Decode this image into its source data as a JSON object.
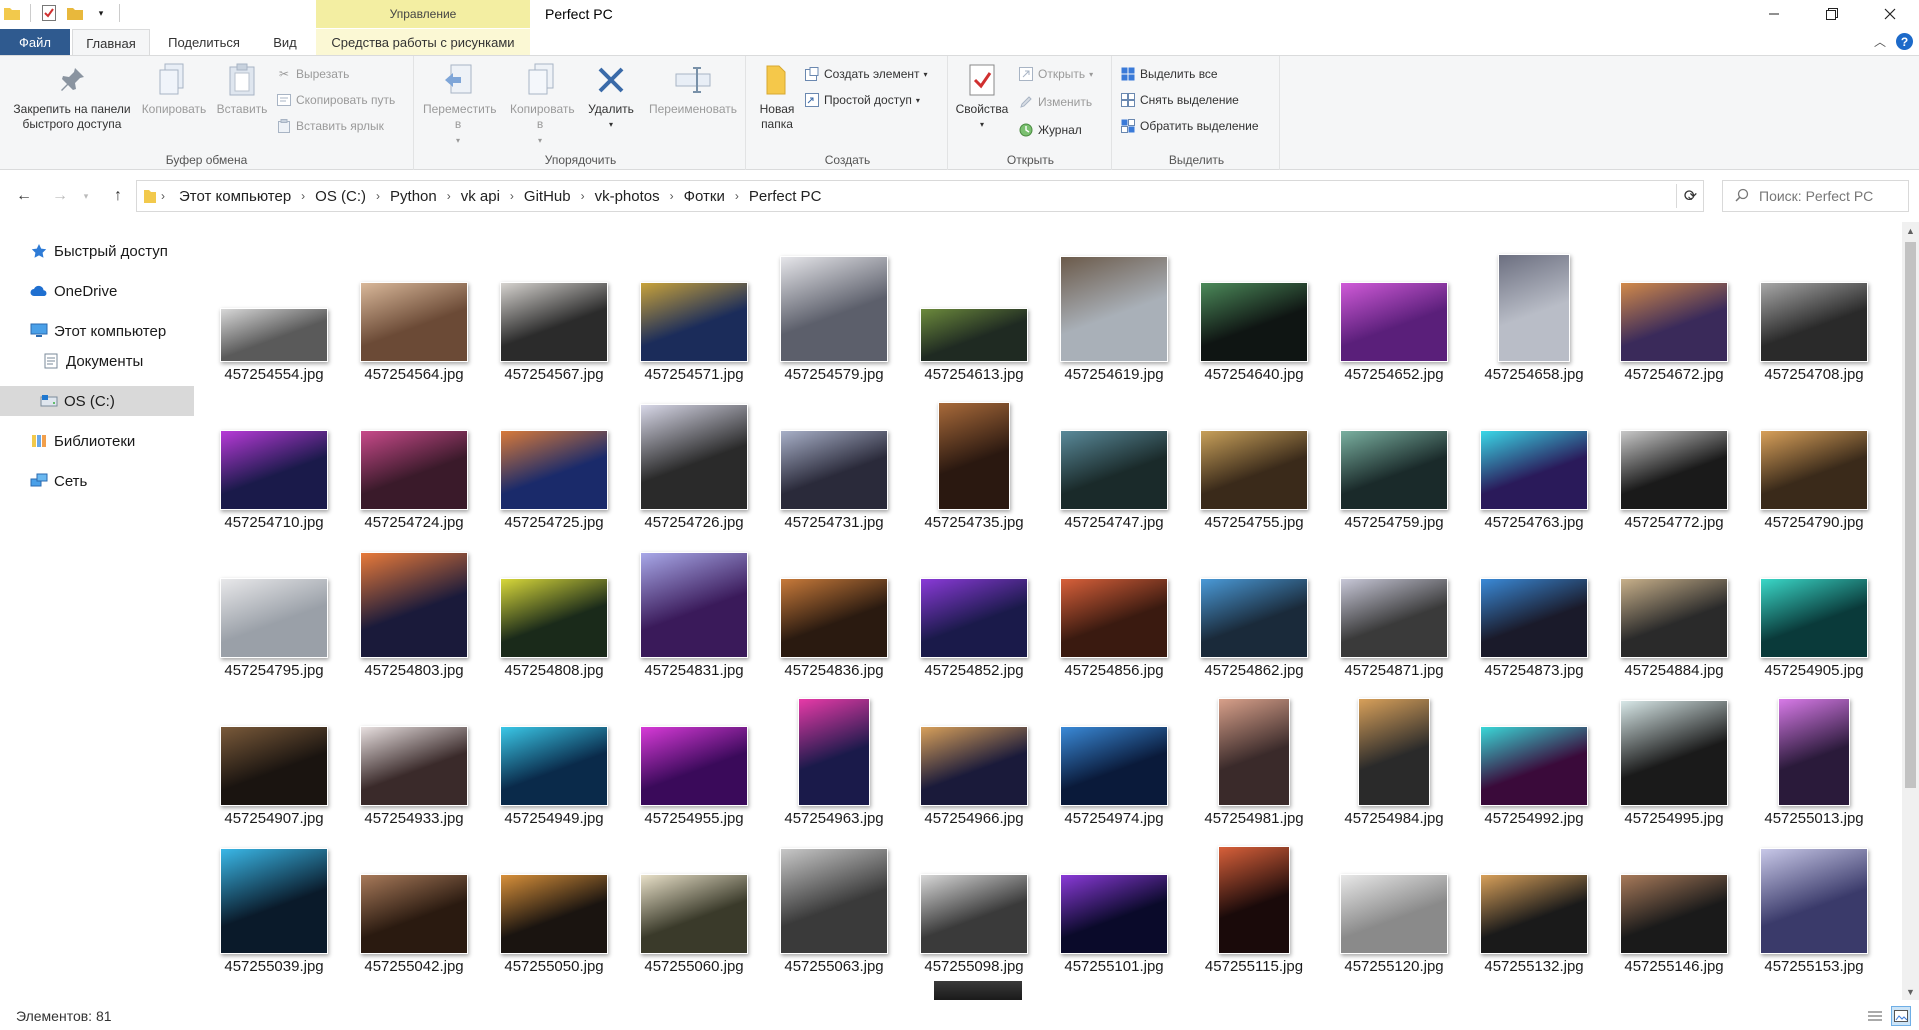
{
  "window": {
    "title": "Perfect PC",
    "context_tab_header": "Управление",
    "minimize_icon": "minimize-icon",
    "maximize_icon": "restore-icon",
    "close_icon": "close-icon"
  },
  "tabs": {
    "file": "Файл",
    "home": "Главная",
    "share": "Поделиться",
    "view": "Вид",
    "picture_tools": "Средства работы с рисунками"
  },
  "ribbon": {
    "clipboard": {
      "label": "Буфер обмена",
      "pin": "Закрепить на панели быстрого доступа",
      "copy": "Копировать",
      "paste": "Вставить",
      "cut": "Вырезать",
      "copy_path": "Скопировать путь",
      "paste_shortcut": "Вставить ярлык"
    },
    "organize": {
      "label": "Упорядочить",
      "move_to": "Переместить в",
      "copy_to": "Копировать в",
      "delete": "Удалить",
      "rename": "Переименовать"
    },
    "create": {
      "label": "Создать",
      "new_folder": "Новая папка",
      "new_item": "Создать элемент",
      "easy_access": "Простой доступ"
    },
    "open": {
      "label": "Открыть",
      "properties": "Свойства",
      "open": "Открыть",
      "edit": "Изменить",
      "history": "Журнал"
    },
    "select": {
      "label": "Выделить",
      "select_all": "Выделить все",
      "select_none": "Снять выделение",
      "invert": "Обратить выделение"
    }
  },
  "breadcrumbs": [
    "Этот компьютер",
    "OS (C:)",
    "Python",
    "vk api",
    "GitHub",
    "vk-photos",
    "Фотки",
    "Perfect PC"
  ],
  "search_placeholder": "Поиск: Perfect PC",
  "nav": {
    "quick_access": "Быстрый доступ",
    "onedrive": "OneDrive",
    "this_pc": "Этот компьютер",
    "documents": "Документы",
    "os_c": "OS (C:)",
    "libraries": "Библиотеки",
    "network": "Сеть"
  },
  "files": [
    {
      "name": "457254554.jpg",
      "orient": "wide",
      "c1": "#5a5a5a",
      "c2": "#d8d8d8"
    },
    {
      "name": "457254564.jpg",
      "orient": "land",
      "c1": "#6b4a36",
      "c2": "#d9b89a"
    },
    {
      "name": "457254567.jpg",
      "orient": "land",
      "c1": "#2b2b2b",
      "c2": "#d6d3cf"
    },
    {
      "name": "457254571.jpg",
      "orient": "land",
      "c1": "#1b2c5a",
      "c2": "#c8a23a"
    },
    {
      "name": "457254579.jpg",
      "orient": "square",
      "c1": "#5c5f6b",
      "c2": "#e6e6ea"
    },
    {
      "name": "457254613.jpg",
      "orient": "wide",
      "c1": "#1f2a22",
      "c2": "#6c8a3c"
    },
    {
      "name": "457254619.jpg",
      "orient": "square",
      "c1": "#a9b0b8",
      "c2": "#6b5a4a"
    },
    {
      "name": "457254640.jpg",
      "orient": "land",
      "c1": "#0f1513",
      "c2": "#4c8a5a"
    },
    {
      "name": "457254652.jpg",
      "orient": "land",
      "c1": "#5a1f7a",
      "c2": "#d05ad8"
    },
    {
      "name": "457254658.jpg",
      "orient": "port",
      "c1": "#b9bdc7",
      "c2": "#6c6f80"
    },
    {
      "name": "457254672.jpg",
      "orient": "land",
      "c1": "#3a2a5a",
      "c2": "#d28a4a"
    },
    {
      "name": "457254708.jpg",
      "orient": "land",
      "c1": "#2a2a2a",
      "c2": "#a8a8a8"
    },
    {
      "name": "457254710.jpg",
      "orient": "land",
      "c1": "#1a1a4a",
      "c2": "#b83ad8"
    },
    {
      "name": "457254724.jpg",
      "orient": "land",
      "c1": "#3a1a2a",
      "c2": "#c84a8a"
    },
    {
      "name": "457254725.jpg",
      "orient": "land",
      "c1": "#1a2a6a",
      "c2": "#d87a3a"
    },
    {
      "name": "457254726.jpg",
      "orient": "square",
      "c1": "#2a2a2a",
      "c2": "#d8d8e8"
    },
    {
      "name": "457254731.jpg",
      "orient": "land",
      "c1": "#2a2a3a",
      "c2": "#a8b0c8"
    },
    {
      "name": "457254735.jpg",
      "orient": "port",
      "c1": "#2a1810",
      "c2": "#a86a3a"
    },
    {
      "name": "457254747.jpg",
      "orient": "land",
      "c1": "#1a2a2a",
      "c2": "#5a8a9a"
    },
    {
      "name": "457254755.jpg",
      "orient": "land",
      "c1": "#3a2a1a",
      "c2": "#c8a05a"
    },
    {
      "name": "457254759.jpg",
      "orient": "land",
      "c1": "#1a2a2a",
      "c2": "#7ab0a0"
    },
    {
      "name": "457254763.jpg",
      "orient": "land",
      "c1": "#2a1a5a",
      "c2": "#3ad8e8"
    },
    {
      "name": "457254772.jpg",
      "orient": "land",
      "c1": "#1a1a1a",
      "c2": "#c8c8c8"
    },
    {
      "name": "457254790.jpg",
      "orient": "land",
      "c1": "#3a2a1a",
      "c2": "#d8a05a"
    },
    {
      "name": "457254795.jpg",
      "orient": "land",
      "c1": "#9aa0a8",
      "c2": "#e8e8ea"
    },
    {
      "name": "457254803.jpg",
      "orient": "square",
      "c1": "#1a1a3a",
      "c2": "#e87a3a"
    },
    {
      "name": "457254808.jpg",
      "orient": "land",
      "c1": "#1a2a1a",
      "c2": "#d8d83a"
    },
    {
      "name": "457254831.jpg",
      "orient": "square",
      "c1": "#3a1a5a",
      "c2": "#a8a8e8"
    },
    {
      "name": "457254836.jpg",
      "orient": "land",
      "c1": "#2a1a10",
      "c2": "#c87a3a"
    },
    {
      "name": "457254852.jpg",
      "orient": "land",
      "c1": "#1a1a4a",
      "c2": "#8a3ad8"
    },
    {
      "name": "457254856.jpg",
      "orient": "land",
      "c1": "#3a1a10",
      "c2": "#d8603a"
    },
    {
      "name": "457254862.jpg",
      "orient": "land",
      "c1": "#1a2a3a",
      "c2": "#4a9ad8"
    },
    {
      "name": "457254871.jpg",
      "orient": "land",
      "c1": "#3a3a3a",
      "c2": "#c8c8d8"
    },
    {
      "name": "457254873.jpg",
      "orient": "land",
      "c1": "#1a1a2a",
      "c2": "#3a8ad8"
    },
    {
      "name": "457254884.jpg",
      "orient": "land",
      "c1": "#2a2a2a",
      "c2": "#c8b08a"
    },
    {
      "name": "457254905.jpg",
      "orient": "land",
      "c1": "#0a3a3a",
      "c2": "#3ad8c8"
    },
    {
      "name": "457254907.jpg",
      "orient": "land",
      "c1": "#1a1410",
      "c2": "#7a5a3a"
    },
    {
      "name": "457254933.jpg",
      "orient": "land",
      "c1": "#3a2a2a",
      "c2": "#e8e0e0"
    },
    {
      "name": "457254949.jpg",
      "orient": "land",
      "c1": "#0a2a4a",
      "c2": "#3ac8e8"
    },
    {
      "name": "457254955.jpg",
      "orient": "land",
      "c1": "#3a0a5a",
      "c2": "#d83ad8"
    },
    {
      "name": "457254963.jpg",
      "orient": "port",
      "c1": "#1a1a4a",
      "c2": "#e83aa8"
    },
    {
      "name": "457254966.jpg",
      "orient": "land",
      "c1": "#1a1a3a",
      "c2": "#d8a05a"
    },
    {
      "name": "457254974.jpg",
      "orient": "land",
      "c1": "#0a1a3a",
      "c2": "#3a8ad8"
    },
    {
      "name": "457254981.jpg",
      "orient": "port",
      "c1": "#3a2a2a",
      "c2": "#d8a08a"
    },
    {
      "name": "457254984.jpg",
      "orient": "port",
      "c1": "#2a2a2a",
      "c2": "#d8a05a"
    },
    {
      "name": "457254992.jpg",
      "orient": "land",
      "c1": "#3a0a3a",
      "c2": "#3ad8d8"
    },
    {
      "name": "457254995.jpg",
      "orient": "square",
      "c1": "#1a1a1a",
      "c2": "#d8e8e8"
    },
    {
      "name": "457255013.jpg",
      "orient": "port",
      "c1": "#2a1a3a",
      "c2": "#d87ae8"
    },
    {
      "name": "457255039.jpg",
      "orient": "square",
      "c1": "#0a1a2a",
      "c2": "#3ab8e8"
    },
    {
      "name": "457255042.jpg",
      "orient": "land",
      "c1": "#2a1a10",
      "c2": "#a87a5a"
    },
    {
      "name": "457255050.jpg",
      "orient": "land",
      "c1": "#1a1410",
      "c2": "#d8903a"
    },
    {
      "name": "457255060.jpg",
      "orient": "land",
      "c1": "#3a3a2a",
      "c2": "#e8e0c8"
    },
    {
      "name": "457255063.jpg",
      "orient": "square",
      "c1": "#3a3a3a",
      "c2": "#c8c8c8"
    },
    {
      "name": "457255098.jpg",
      "orient": "land",
      "c1": "#3a3a3a",
      "c2": "#d8d8d8"
    },
    {
      "name": "457255101.jpg",
      "orient": "land",
      "c1": "#0a0a2a",
      "c2": "#8a3ad8"
    },
    {
      "name": "457255115.jpg",
      "orient": "port",
      "c1": "#1a0a0a",
      "c2": "#d8603a"
    },
    {
      "name": "457255120.jpg",
      "orient": "land",
      "c1": "#8a8a8a",
      "c2": "#e8e8e8"
    },
    {
      "name": "457255132.jpg",
      "orient": "land",
      "c1": "#1a1a1a",
      "c2": "#d8a05a"
    },
    {
      "name": "457255146.jpg",
      "orient": "land",
      "c1": "#1a1a1a",
      "c2": "#a87a5a"
    },
    {
      "name": "457255153.jpg",
      "orient": "square",
      "c1": "#3a3a6a",
      "c2": "#c8c8e8"
    }
  ],
  "status": {
    "item_count": "Элементов: 81",
    "details_view_icon": "details-view-icon",
    "large_icons_view_icon": "large-icons-view-icon"
  }
}
